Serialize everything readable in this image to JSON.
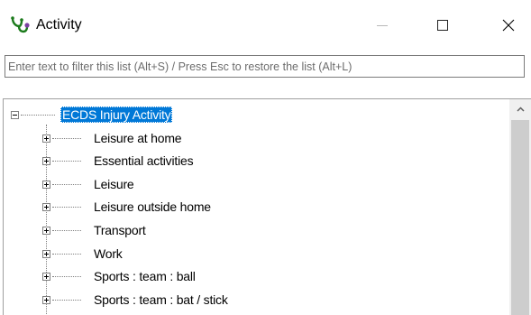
{
  "window": {
    "title": "Activity",
    "icon": "stethoscope-app-icon"
  },
  "filter": {
    "placeholder": "Enter text to filter this list (Alt+S) / Press Esc to restore the list (Alt+L)",
    "value": ""
  },
  "tree": {
    "root": {
      "label": "ECDS Injury Activity",
      "expanded": true,
      "selected": true
    },
    "children": [
      {
        "label": "Leisure at home"
      },
      {
        "label": "Essential activities"
      },
      {
        "label": "Leisure"
      },
      {
        "label": "Leisure outside home"
      },
      {
        "label": "Transport"
      },
      {
        "label": "Work"
      },
      {
        "label": "Sports : team : ball"
      },
      {
        "label": "Sports : team : bat / stick"
      }
    ]
  },
  "colors": {
    "selection": "#0078d7",
    "scrollbar_track": "#f0f0f0",
    "scrollbar_thumb": "#cdcdcd"
  }
}
